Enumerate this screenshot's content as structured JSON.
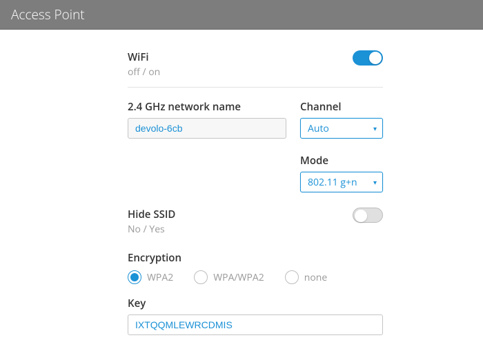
{
  "header": {
    "title": "Access Point"
  },
  "wifi": {
    "label": "WiFi",
    "sublabel": "off / on",
    "enabled": true
  },
  "networkName": {
    "label": "2.4 GHz network name",
    "value": "devolo-6cb"
  },
  "channel": {
    "label": "Channel",
    "value": "Auto"
  },
  "mode": {
    "label": "Mode",
    "value": "802.11 g+n"
  },
  "hideSsid": {
    "label": "Hide SSID",
    "sublabel": "No / Yes",
    "enabled": false
  },
  "encryption": {
    "label": "Encryption",
    "selected": "WPA2",
    "options": [
      "WPA2",
      "WPA/WPA2",
      "none"
    ]
  },
  "key": {
    "label": "Key",
    "value": "IXTQQMLEWRCDMIS"
  }
}
